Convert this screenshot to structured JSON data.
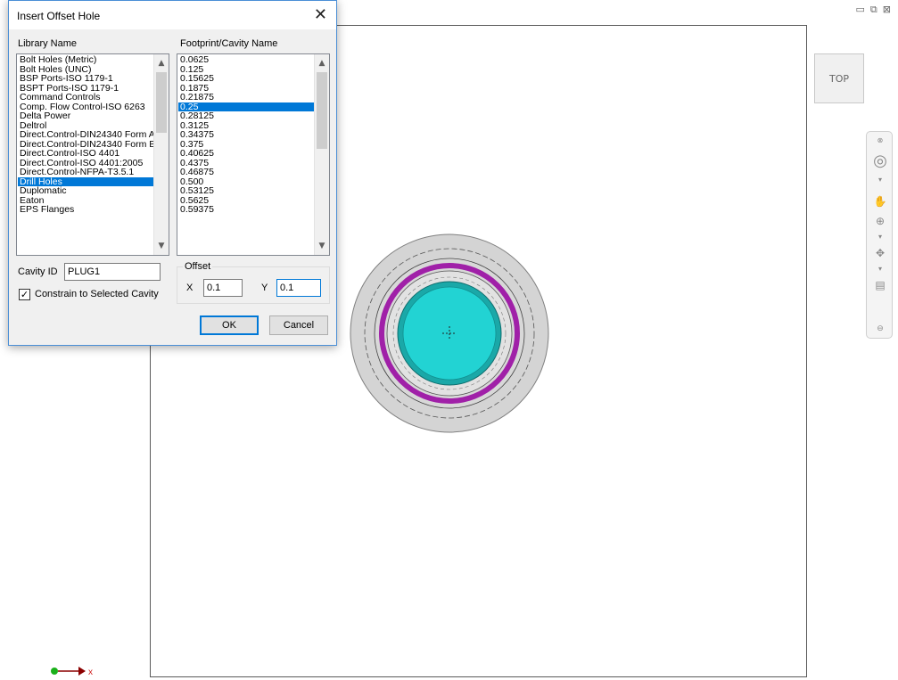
{
  "window_controls": {
    "minimize": "▭",
    "restore": "⧉",
    "close": "⊠"
  },
  "viewcube": {
    "label": "TOP"
  },
  "axis": {
    "x_label": "x"
  },
  "dialog": {
    "title": "Insert Offset Hole",
    "close_label": "✕",
    "library_label": "Library Name",
    "footprint_label": "Footprint/Cavity Name",
    "library_items": [
      "Bolt Holes (Metric)",
      "Bolt Holes (UNC)",
      "BSP Ports-ISO 1179-1",
      "BSPT Ports-ISO 1179-1",
      "Command Controls",
      "Comp. Flow Control-ISO 6263",
      "Delta Power",
      "Deltrol",
      "Direct.Control-DIN24340 Form A",
      "Direct.Control-DIN24340 Form B",
      "Direct.Control-ISO 4401",
      "Direct.Control-ISO 4401:2005",
      "Direct.Control-NFPA-T3.5.1",
      "Drill Holes",
      "Duplomatic",
      "Eaton",
      "EPS Flanges"
    ],
    "library_selected_index": 13,
    "footprint_items": [
      "0.0625",
      "0.125",
      "0.15625",
      "0.1875",
      "0.21875",
      "0.25",
      "0.28125",
      "0.3125",
      "0.34375",
      "0.375",
      "0.40625",
      "0.4375",
      "0.46875",
      "0.500",
      "0.53125",
      "0.5625",
      "0.59375"
    ],
    "footprint_selected_index": 5,
    "cavity_id_label": "Cavity ID",
    "cavity_id_value": "PLUG1",
    "offset_label": "Offset",
    "x_label": "X",
    "x_value": "0.1",
    "y_label": "Y",
    "y_value": "0.1",
    "constrain_label": "Constrain to Selected Cavity",
    "constrain_checked": true,
    "ok_label": "OK",
    "cancel_label": "Cancel"
  },
  "colors": {
    "selection": "#0078d7",
    "ring_outer": "#d4d4d4",
    "oring": "#a020a8",
    "bore": "#22d3d3",
    "bore_rim": "#1aa8a8",
    "dialog_border": "#4b8fd6"
  }
}
